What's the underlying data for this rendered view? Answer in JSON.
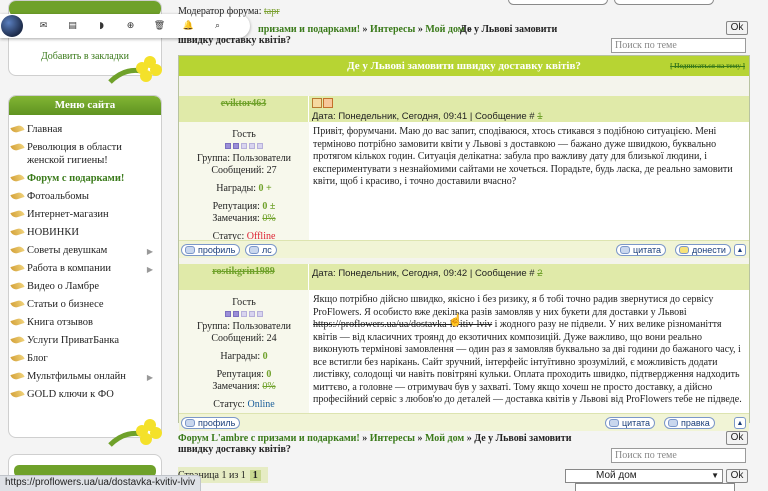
{
  "toolbar": {
    "icons": [
      "avatar",
      "mail-icon",
      "document-icon",
      "chat-icon",
      "plus-icon",
      "trash-icon",
      "bell-icon",
      "search-icon"
    ],
    "glyphs": [
      "✉",
      "▤",
      "◗",
      "⊕",
      "🗑",
      "🔔",
      "⌕"
    ]
  },
  "left": {
    "bookmark": "Добавить в закладки",
    "menu_title": "Меню сайта",
    "menu": [
      {
        "label": "Главная",
        "bold": false,
        "arrow": false
      },
      {
        "label": "Революция в области женской гигиены!",
        "bold": false,
        "arrow": false
      },
      {
        "label": "Форум с подарками!",
        "bold": true,
        "arrow": false
      },
      {
        "label": "Фотоальбомы",
        "bold": false,
        "arrow": false
      },
      {
        "label": "Интернет-магазин",
        "bold": false,
        "arrow": false
      },
      {
        "label": "НОВИНКИ",
        "bold": false,
        "arrow": false
      },
      {
        "label": "Советы девушкам",
        "bold": false,
        "arrow": true
      },
      {
        "label": "Работа в компании",
        "bold": false,
        "arrow": true
      },
      {
        "label": "Видео о Ламбре",
        "bold": false,
        "arrow": false
      },
      {
        "label": "Статьи о бизнесе",
        "bold": false,
        "arrow": false
      },
      {
        "label": "Книга отзывов",
        "bold": false,
        "arrow": false
      },
      {
        "label": "Услуги ПриватБанка",
        "bold": false,
        "arrow": false
      },
      {
        "label": "Блог",
        "bold": false,
        "arrow": false
      },
      {
        "label": "Мультфильмы онлайн",
        "bold": false,
        "arrow": true
      },
      {
        "label": "GOLD ключи к ФО",
        "bold": false,
        "arrow": false
      }
    ]
  },
  "header": {
    "moderator_label": "Модератор форума:",
    "moderator_name": "tapr",
    "crumb_prefix_1": "призами и подарками!",
    "crumb_sep": "»",
    "crumb_2": "Интересы",
    "crumb_3": "Мой дом",
    "crumb_current": "Де у Львові замовити швидку доставку квітів?",
    "ok": "Ok",
    "search_placeholder": "Поиск по теме"
  },
  "topic": {
    "title": "Де у Львові замовити швидку доставку квітів?",
    "subscribe": "[ Подписаться на тему ]"
  },
  "posts": [
    {
      "nick": "eviktor463",
      "date": "Дата: Понедельник, Сегодня, 09:41 | Сообщение #",
      "num": "1",
      "rank": "Гость",
      "group": "Группа: Пользователи",
      "messages": "Сообщений: 27",
      "awards_label": "Награды:",
      "awards_value": "0",
      "awards_plus": "+",
      "rep_label": "Репутация:",
      "rep_value": "0",
      "rep_pm": "±",
      "warn_label": "Замечания:",
      "warn_value": "0%",
      "status_label": "Статус:",
      "status": "Offline",
      "text": "Привіт, форумчани. Маю до вас запит, сподіваюся, хтось стикався з подібною ситуацією. Мені терміново потрібно замовити квіти у Львові з доставкою — бажано дуже швидкою, буквально протягом кількох годин. Ситуація делікатна: забула про важливу дату для близької людини, і експериментувати з незнайомими сайтами не хочеться. Порадьте, будь ласка, де реально замовити квіти, щоб і красиво, і точно доставили вчасно?",
      "text_pre": "",
      "text_link": "",
      "text_post": ""
    },
    {
      "nick": "rostikgrin1989",
      "date": "Дата: Понедельник, Сегодня, 09:42 | Сообщение #",
      "num": "2",
      "rank": "Гость",
      "group": "Группа: Пользователи",
      "messages": "Сообщений: 24",
      "awards_label": "Награды:",
      "awards_value": "0",
      "awards_plus": "",
      "rep_label": "Репутация:",
      "rep_value": "0",
      "rep_pm": "",
      "warn_label": "Замечания:",
      "warn_value": "0%",
      "status_label": "Статус:",
      "status": "Online",
      "text": "",
      "text_pre": "Якщо потрібно дійсно швидко, якісно і без ризику, я б тобі точно радив звернутися до сервісу ProFlowers. Я особисто вже декілька разів замовляв у них букети для доставки у Львові ",
      "text_link": "https://proflowers.ua/ua/dostavka-kvitiv-lviv",
      "text_post": " і жодного разу не підвели. У них велике різноманіття квітів — від класичних троянд до екзотичних композицій. Дуже важливо, що вони реально виконують термінові замовлення — один раз я замовляв буквально за дві години до бажаного часу, і все встигли без нарікань. Сайт зручний, інтерфейс інтуїтивно зрозумілий, є можливість додати листівку, солодощі чи навіть повітряні кульки. Оплата проходить швидко, підтвердження надходить миттєво, а головне — отримувач був у захваті. Тому якщо хочеш не просто доставку, а дійсно професійний сервіс з любов'ю до деталей — доставка квітів у Львові від ProFlowers тебе не підведе."
    }
  ],
  "post_buttons": {
    "profile": "профиль",
    "pm": "лс",
    "quote": "цитата",
    "report": "донести",
    "edit": "правка"
  },
  "footer": {
    "crumb_1": "Форум L'ambre с призами и подарками!",
    "crumb_2": "Интересы",
    "crumb_3": "Мой дом",
    "crumb_current": "Де у Львові замовити швидку доставку квітів?",
    "ok": "Ok",
    "search_placeholder": "Поиск по теме",
    "pages_label": "Страница 1 из 1",
    "current_page": "1",
    "jump_value": "Мой дом"
  },
  "status_url": "https://proflowers.ua/ua/dostavka-kvitiv-lviv"
}
